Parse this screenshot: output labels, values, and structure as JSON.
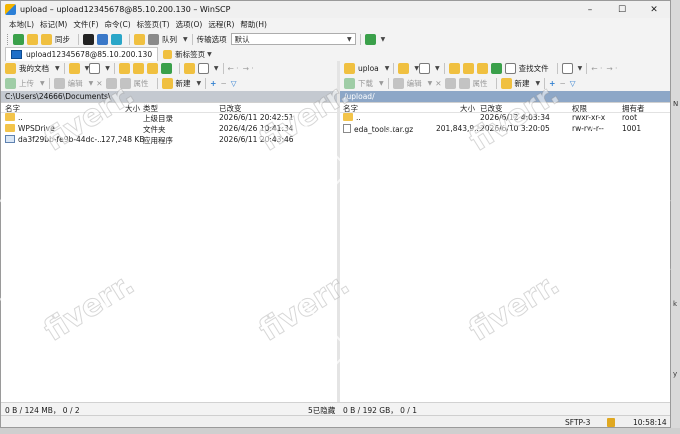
{
  "window": {
    "title": "upload – upload12345678@85.10.200.130 – WinSCP",
    "controls": [
      "–",
      "☐",
      "✕"
    ]
  },
  "menu": [
    "本地(L)",
    "标记(M)",
    "文件(F)",
    "命令(C)",
    "标签页(T)",
    "选项(O)",
    "远程(R)",
    "帮助(H)"
  ],
  "toolbar": {
    "sync_label": "同步",
    "queue_label": "队列",
    "transfer_options_label": "传输选项",
    "transfer_preset": "默认"
  },
  "tabs": {
    "session": "upload12345678@85.10.200.130",
    "new_tab": "新标签页"
  },
  "local": {
    "location": "我的文档",
    "upload_label": "上传",
    "edit_label": "编辑",
    "properties_label": "属性",
    "new_label": "新建",
    "path": "C:\\Users\\24666\\Documents\\",
    "columns": [
      "名字",
      "大小",
      "类型",
      "已改变"
    ],
    "files": [
      {
        "name": "..",
        "size": "",
        "type": "上级目录",
        "changed": "2026/6/11 20:42:51"
      },
      {
        "name": "WPSDrive",
        "size": "",
        "type": "文件夹",
        "changed": "2026/4/26 10:41:34"
      },
      {
        "name": "da3f29bb-fe9b-44dc-...",
        "size": "127,248 KB",
        "type": "应用程序",
        "changed": "2026/6/11 20:43:46"
      }
    ],
    "status": "0 B / 124 MB，  0 / 2",
    "hidden": "5已隐藏"
  },
  "remote": {
    "location": "uploa",
    "find_label": "查找文件",
    "download_label": "下载",
    "edit_label": "编辑",
    "properties_label": "属性",
    "new_label": "新建",
    "path": "/upload/",
    "columns": [
      "名字",
      "大小",
      "已改变",
      "权限",
      "拥有者"
    ],
    "files": [
      {
        "name": "..",
        "size": "",
        "changed": "2026/6/12 4:03:34",
        "rights": "rwxr-xr-x",
        "owner": "root"
      },
      {
        "name": "eda_tools.tar.gz",
        "size": "201,843,9...",
        "changed": "2026/6/10 3:20:05",
        "rights": "rw-rw-r--",
        "owner": "1001"
      }
    ],
    "status": "0 B / 192 GB，  0 / 1"
  },
  "statusbar": {
    "protocol": "SFTP-3",
    "time": "10:58:14"
  },
  "watermark": "fiverr.",
  "colors": {
    "active_path": "#8da7c7",
    "inactive_path": "#c4c9d0"
  }
}
